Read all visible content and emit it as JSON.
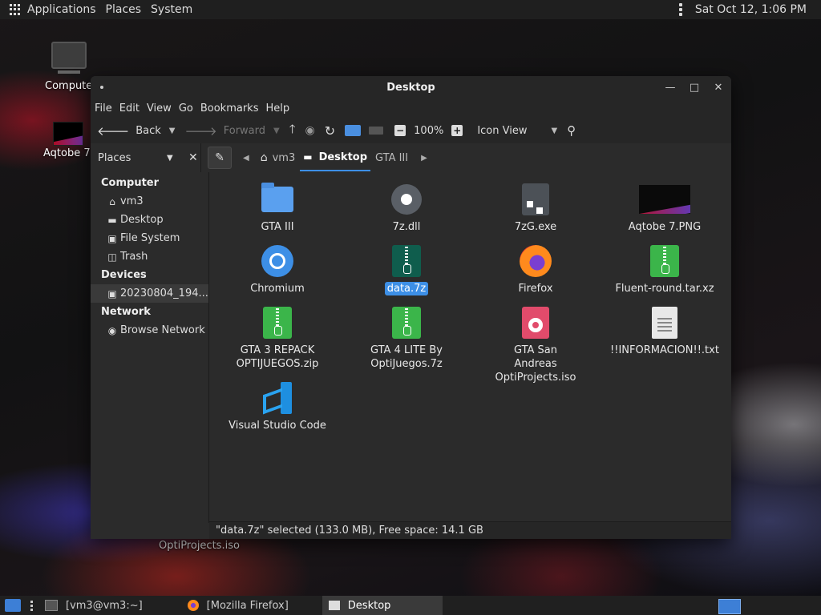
{
  "top_panel": {
    "applications": "Applications",
    "places": "Places",
    "system": "System",
    "clock": "Sat Oct 12,  1:06 PM"
  },
  "desktop": {
    "icons": [
      {
        "label": "Compute",
        "icon": "computer-icon"
      },
      {
        "label": "Aqtobe 7.",
        "icon": "image-thumbnail-icon"
      }
    ],
    "underlay_label": "OptiProjects.iso"
  },
  "window": {
    "title": "Desktop",
    "menu": [
      "File",
      "Edit",
      "View",
      "Go",
      "Bookmarks",
      "Help"
    ],
    "toolbar": {
      "back": "Back",
      "forward": "Forward",
      "zoom": "100%",
      "view_mode": "Icon View"
    },
    "places_selector": "Places",
    "breadcrumb": [
      "vm3",
      "Desktop",
      "GTA III"
    ],
    "sidebar": {
      "sections": [
        {
          "heading": "Computer",
          "items": [
            {
              "label": "vm3",
              "icon": "home-icon"
            },
            {
              "label": "Desktop",
              "icon": "desktop-icon"
            },
            {
              "label": "File System",
              "icon": "drive-icon"
            },
            {
              "label": "Trash",
              "icon": "trash-icon"
            }
          ]
        },
        {
          "heading": "Devices",
          "items": [
            {
              "label": "20230804_194...",
              "icon": "drive-icon"
            }
          ]
        },
        {
          "heading": "Network",
          "items": [
            {
              "label": "Browse Network",
              "icon": "network-icon"
            }
          ]
        }
      ]
    },
    "files": [
      {
        "name": "GTA III",
        "type": "folder"
      },
      {
        "name": "7z.dll",
        "type": "library"
      },
      {
        "name": "7zG.exe",
        "type": "executable"
      },
      {
        "name": "Aqtobe 7.PNG",
        "type": "image"
      },
      {
        "name": "Chromium",
        "type": "chromium"
      },
      {
        "name": "data.7z",
        "type": "archive"
      },
      {
        "name": "Firefox",
        "type": "firefox"
      },
      {
        "name": "Fluent-round.tar.xz",
        "type": "archive"
      },
      {
        "name": "GTA 3 REPACK OPTIJUEGOS.zip",
        "type": "archive"
      },
      {
        "name": "GTA 4 LITE By OptiJuegos.7z",
        "type": "archive"
      },
      {
        "name": "GTA San Andreas OptiProjects.iso",
        "type": "disc-image"
      },
      {
        "name": "!!INFORMACION!!.txt",
        "type": "text"
      },
      {
        "name": "Visual Studio Code",
        "type": "vscode"
      }
    ],
    "status": "\"data.7z\" selected (133.0 MB), Free space: 14.1 GB"
  },
  "taskbar": {
    "tasks": [
      {
        "label": "[vm3@vm3:~]"
      },
      {
        "label": "[Mozilla Firefox]"
      },
      {
        "label": "Desktop"
      }
    ]
  },
  "colors": {
    "accent": "#3d8fe6",
    "window_bg": "#2b2b2b",
    "panel_bg": "#1f1f1f"
  }
}
